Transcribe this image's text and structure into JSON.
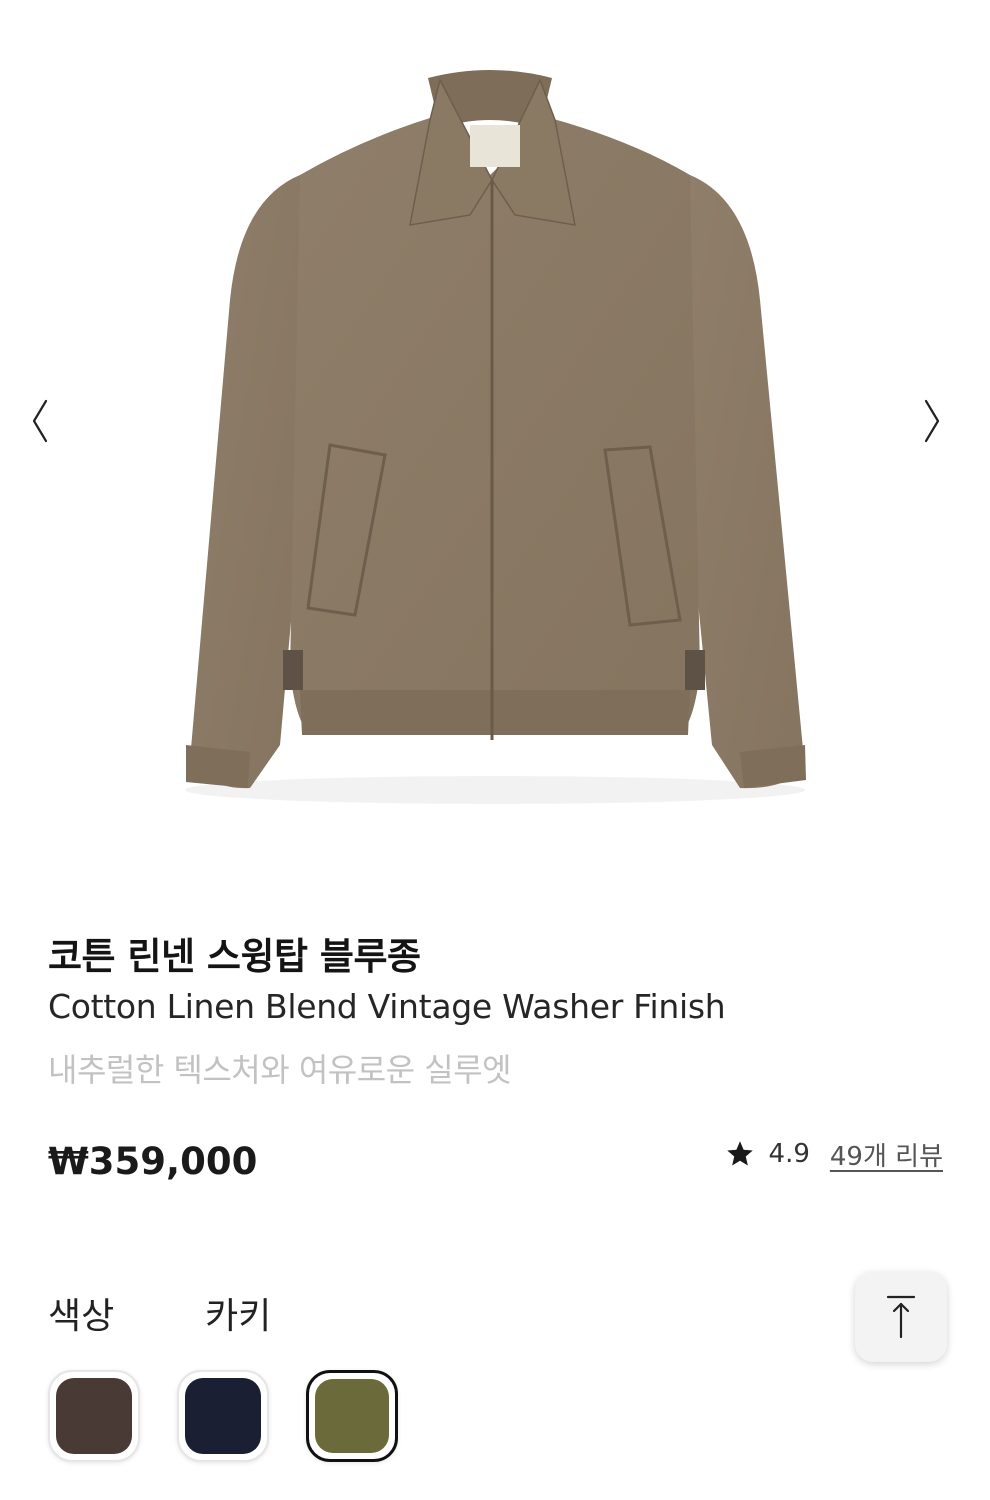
{
  "product": {
    "title_ko": "코튼 린넨 스윙탑 블루종",
    "title_en": "Cotton Linen Blend Vintage Washer Finish",
    "subtitle": "내추럴한 텍스처와 여유로운 실루엣",
    "price": "₩359,000"
  },
  "rating": {
    "icon": "star-icon",
    "value": "4.9",
    "review_link": "49개 리뷰"
  },
  "gallery": {
    "prev_icon": "chevron-left-icon",
    "next_icon": "chevron-right-icon",
    "image_subject": "jacket",
    "jacket_color": "#8c7b66"
  },
  "color_option": {
    "label": "색상",
    "selected": "카키",
    "swatches": [
      {
        "color": "#4a3a35",
        "selected": false
      },
      {
        "color": "#1a1f33",
        "selected": false
      },
      {
        "color": "#6b6a3a",
        "selected": true
      }
    ]
  },
  "scroll_top": {
    "icon": "arrow-up-icon"
  }
}
